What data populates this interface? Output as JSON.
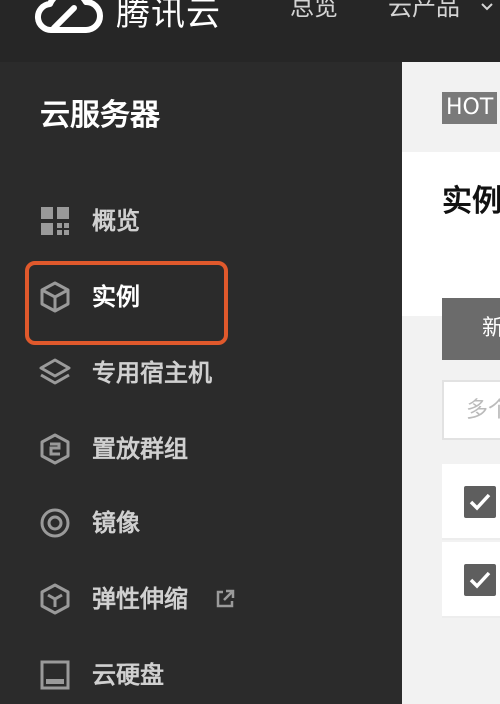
{
  "header": {
    "brand": "腾讯云",
    "nav": [
      {
        "label": "总览"
      },
      {
        "label": "云产品"
      }
    ]
  },
  "sidebar": {
    "title": "云服务器",
    "items": [
      {
        "label": "概览",
        "icon": "grid-icon"
      },
      {
        "label": "实例",
        "icon": "cube-icon",
        "active": true
      },
      {
        "label": "专用宿主机",
        "icon": "layers-icon"
      },
      {
        "label": "置放群组",
        "icon": "hexagon-icon"
      },
      {
        "label": "镜像",
        "icon": "target-icon"
      },
      {
        "label": "弹性伸缩",
        "icon": "box-icon",
        "external": true
      },
      {
        "label": "云硬盘",
        "icon": "disk-icon"
      }
    ]
  },
  "main": {
    "badge": "HOT",
    "page_title": "实例",
    "new_button": "新",
    "search_placeholder": "多个",
    "rows": [
      {
        "checked": true
      },
      {
        "checked": true
      }
    ]
  },
  "colors": {
    "sidebar_bg": "#2b2b2b",
    "topbar_bg": "#262626",
    "highlight": "#e0592c",
    "content_bg": "#f2f2f2"
  }
}
